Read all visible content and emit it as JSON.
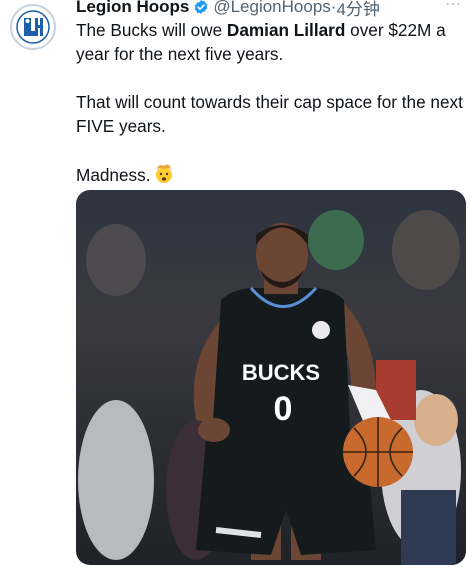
{
  "tweet": {
    "author_name": "Legion Hoops",
    "handle": "@LegionHoops",
    "separator": "·",
    "time": "4分钟",
    "line1_pre": "The Bucks will owe ",
    "line1_bold": "Damian Lillard",
    "line1_post": " over $22M a year for the next five years.",
    "line2": "That will count towards their cap space for the next FIVE years.",
    "line3": "Madness.",
    "more_icon": "⋯"
  },
  "photo": {
    "jersey_text": "BUCKS",
    "jersey_number": "0"
  },
  "colors": {
    "verified": "#1d9bf0",
    "jersey": "#151a1d",
    "ball": "#c86a2e"
  },
  "icons": [
    "avatar-logo-icon",
    "verified-badge-icon",
    "more-icon",
    "mind-blown-emoji-icon"
  ]
}
